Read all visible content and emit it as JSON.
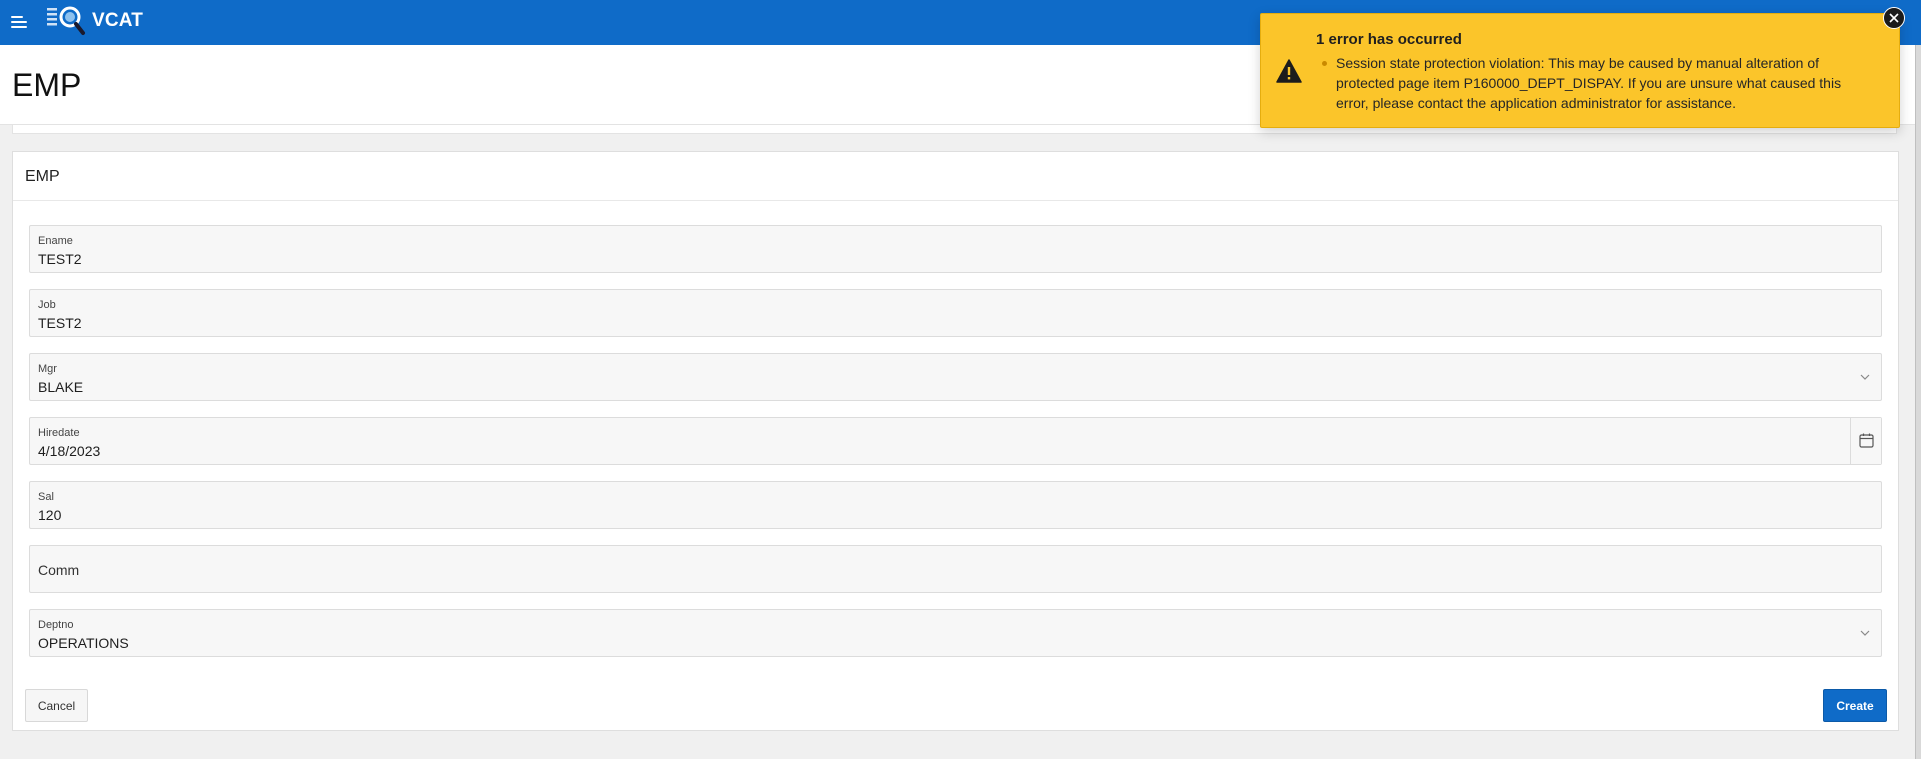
{
  "header": {
    "menu_icon": "hamburger-menu-icon",
    "logo_icon": "vcat-logo-icon",
    "app_name": "VCAT",
    "brand_color": "#0f6bc8"
  },
  "page": {
    "title": "EMP"
  },
  "region": {
    "title": "EMP",
    "fields": [
      {
        "label": "Ename",
        "value": "TEST2",
        "type": "text"
      },
      {
        "label": "Job",
        "value": "TEST2",
        "type": "text"
      },
      {
        "label": "Mgr",
        "value": "BLAKE",
        "type": "select",
        "icon": "chevron-down-icon"
      },
      {
        "label": "Hiredate",
        "value": "4/18/2023",
        "type": "date",
        "icon": "calendar-icon"
      },
      {
        "label": "Sal",
        "value": "120",
        "type": "text"
      },
      {
        "label": "Comm",
        "value": "",
        "type": "text"
      },
      {
        "label": "Deptno",
        "value": "OPERATIONS",
        "type": "select",
        "icon": "chevron-down-icon"
      }
    ],
    "buttons": {
      "cancel": "Cancel",
      "create": "Create"
    }
  },
  "alert": {
    "icon": "warning-icon",
    "title": "1 error has occurred",
    "messages": [
      "Session state protection violation: This may be caused by manual alteration of protected page item P160000_DEPT_DISPAY. If you are unsure what caused this error, please contact the application administrator for assistance."
    ],
    "close_icon": "close-icon",
    "color": "#fbc52a"
  }
}
